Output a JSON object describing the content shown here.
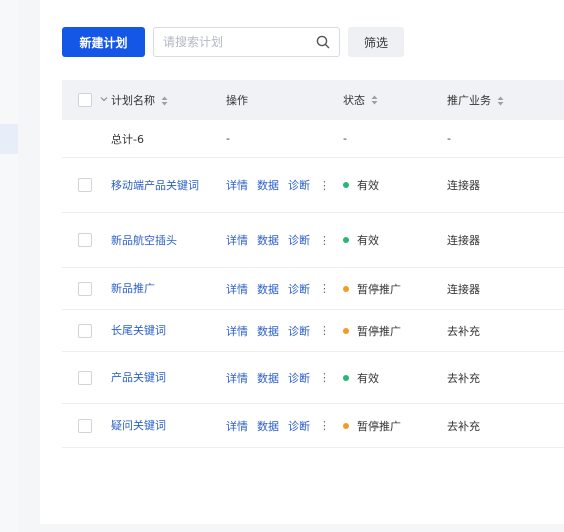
{
  "toolbar": {
    "new_plan_label": "新建计划",
    "search_placeholder": "请搜索计划",
    "filter_label": "筛选"
  },
  "table": {
    "columns": {
      "name": "计划名称",
      "actions": "操作",
      "status": "状态",
      "business": "推广业务"
    },
    "total": {
      "name": "总计-6",
      "actions": "-",
      "status": "-",
      "business": "-"
    },
    "action_labels": {
      "detail": "详情",
      "data": "数据",
      "diagnose": "诊断",
      "more": "⋮"
    },
    "rows": [
      {
        "name": "移动端产品关键词",
        "status": "有效",
        "status_color": "#2bb673",
        "business": "连接器"
      },
      {
        "name": "新品航空插头",
        "status": "有效",
        "status_color": "#2bb673",
        "business": "连接器"
      },
      {
        "name": "新品推广",
        "status": "暂停推广",
        "status_color": "#f59a23",
        "business": "连接器"
      },
      {
        "name": "长尾关键词",
        "status": "暂停推广",
        "status_color": "#f59a23",
        "business": "去补充"
      },
      {
        "name": "产品关键词",
        "status": "有效",
        "status_color": "#2bb673",
        "business": "去补充"
      },
      {
        "name": "疑问关键词",
        "status": "暂停推广",
        "status_color": "#f59a23",
        "business": "去补充"
      }
    ]
  }
}
